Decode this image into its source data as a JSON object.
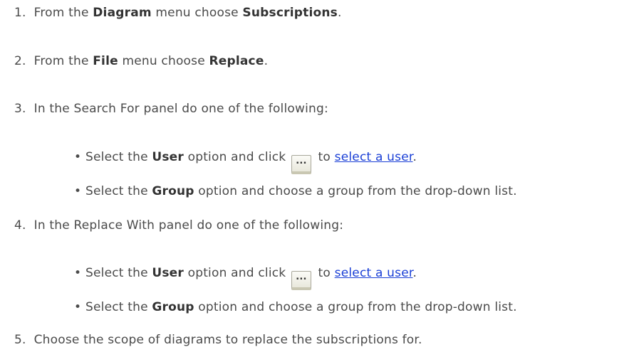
{
  "steps": [
    {
      "num": "1.",
      "pre": "From the ",
      "bold1": "Diagram",
      "mid": " menu choose ",
      "bold2": "Subscriptions",
      "post": "."
    },
    {
      "num": "2.",
      "pre": "From the ",
      "bold1": "File",
      "mid": " menu choose ",
      "bold2": "Replace",
      "post": "."
    },
    {
      "num": "3.",
      "text": "In the Search For panel do one of the following:",
      "bullets": [
        {
          "pre": "Select the ",
          "bold": "User",
          "mid": " option and click ",
          "button_label": "...",
          "after": " to ",
          "link": "select a user",
          "post": "."
        },
        {
          "pre": "Select the ",
          "bold": "Group",
          "post": " option and choose a group from the drop-down list."
        }
      ]
    },
    {
      "num": "4.",
      "text": "In the Replace With panel do one of the following:",
      "bullets": [
        {
          "pre": "Select the ",
          "bold": "User",
          "mid": " option and click ",
          "button_label": "...",
          "after": " to ",
          "link": "select a user",
          "post": "."
        },
        {
          "pre": "Select the ",
          "bold": "Group",
          "post": " option and choose a group from the drop-down list."
        }
      ]
    },
    {
      "num": "5.",
      "text": "Choose the scope of diagrams to replace the subscriptions for."
    }
  ],
  "bullet_glyph": "•"
}
